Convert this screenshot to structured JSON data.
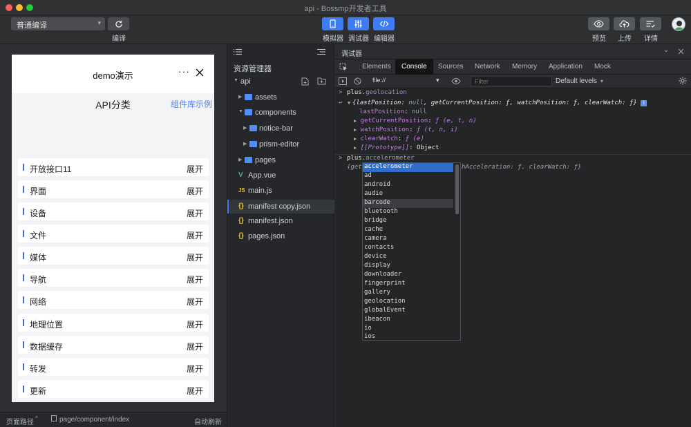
{
  "window": {
    "title": "api - Bossmp开发者工具"
  },
  "toolbar": {
    "compile_mode": "普通编译",
    "compile_label": "编译",
    "simulator_label": "模拟器",
    "debugger_label": "调试器",
    "editor_label": "编辑器",
    "preview_label": "预览",
    "upload_label": "上传",
    "details_label": "详情",
    "accent_color": "#3d7cf5"
  },
  "simulator": {
    "nav_title": "demo演示",
    "more_icon": "···",
    "section_title": "API分类",
    "example_link": "组件库示例",
    "items": [
      {
        "name": "开放接口11",
        "toggle": "展开"
      },
      {
        "name": "界面",
        "toggle": "展开"
      },
      {
        "name": "设备",
        "toggle": "展开"
      },
      {
        "name": "文件",
        "toggle": "展开"
      },
      {
        "name": "媒体",
        "toggle": "展开"
      },
      {
        "name": "导航",
        "toggle": "展开"
      },
      {
        "name": "网络",
        "toggle": "展开"
      },
      {
        "name": "地理位置",
        "toggle": "展开"
      },
      {
        "name": "数据缓存",
        "toggle": "展开"
      },
      {
        "name": "转发",
        "toggle": "展开"
      },
      {
        "name": "更新",
        "toggle": "展开"
      }
    ]
  },
  "statusbar": {
    "page_path_label": "页面路径",
    "page_path": "page/component/index",
    "auto_refresh": "自动刷新"
  },
  "explorer": {
    "title": "资源管理器",
    "root": "api",
    "items": [
      {
        "label": "assets",
        "kind": "folder"
      },
      {
        "label": "components",
        "kind": "folder"
      },
      {
        "label": "notice-bar",
        "kind": "folder"
      },
      {
        "label": "prism-editor",
        "kind": "folder"
      },
      {
        "label": "pages",
        "kind": "folder"
      },
      {
        "label": "App.vue",
        "kind": "vue",
        "icon": "V"
      },
      {
        "label": "main.js",
        "kind": "js",
        "icon": "JS"
      },
      {
        "label": "manifest copy.json",
        "kind": "json",
        "icon": "{}"
      },
      {
        "label": "manifest.json",
        "kind": "json",
        "icon": "{}"
      },
      {
        "label": "pages.json",
        "kind": "json",
        "icon": "{}"
      }
    ]
  },
  "debugger": {
    "title": "调试器",
    "tabs": [
      "Elements",
      "Console",
      "Sources",
      "Network",
      "Memory",
      "Application",
      "Mock"
    ],
    "active_tab": "Console",
    "context": "file://",
    "filter_placeholder": "Filter",
    "levels": "Default levels",
    "console": {
      "cmd1": "plus.geolocation",
      "cmd1_obj": "plus.",
      "cmd1_prop": "geolocation",
      "summary_open": "{lastPosition: ",
      "summary_null": "null",
      "summary_rest": ", getCurrentPosition: ƒ, watchPosition: ƒ, clearWatch: ƒ}",
      "last_position_key": "lastPosition",
      "last_position_val": "null",
      "get_current_key": "getCurrentPosition",
      "get_current_val": "ƒ (e, t, n)",
      "watch_key": "watchPosition",
      "watch_val": "ƒ (t, n, i)",
      "clear_key": "clearWatch",
      "clear_val": "ƒ (e)",
      "proto_key": "[[Prototype]]",
      "proto_val": "Object",
      "cmd2_typed": "plus.",
      "cmd2_suggest": "accelerometer",
      "preview_left": "{get",
      "preview_right": "hAcceleration: ƒ, clearWatch: ƒ}"
    },
    "autocomplete": [
      "accelerometer",
      "ad",
      "android",
      "audio",
      "barcode",
      "bluetooth",
      "bridge",
      "cache",
      "camera",
      "contacts",
      "device",
      "display",
      "downloader",
      "fingerprint",
      "gallery",
      "geolocation",
      "globalEvent",
      "ibeacon",
      "io",
      "ios"
    ]
  }
}
